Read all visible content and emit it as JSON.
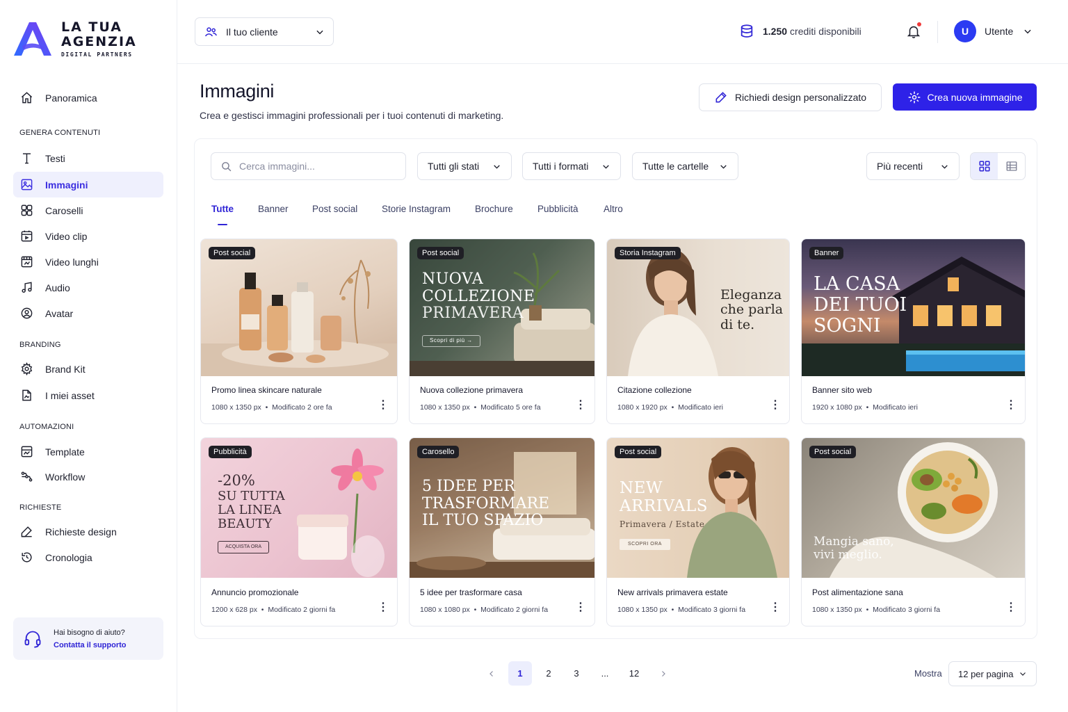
{
  "brand": {
    "line1": "LA TUA",
    "line2": "AGENZIA",
    "line3": "DIGITAL PARTNERS"
  },
  "sidebar": {
    "top": {
      "label": "Panoramica",
      "icon": "home-icon"
    },
    "sections": [
      {
        "title": "GENERA CONTENUTI",
        "items": [
          {
            "label": "Testi",
            "icon": "text-icon"
          },
          {
            "label": "Immagini",
            "icon": "image-icon",
            "active": true
          },
          {
            "label": "Caroselli",
            "icon": "grid-icon"
          },
          {
            "label": "Video clip",
            "icon": "video-icon"
          },
          {
            "label": "Video lunghi",
            "icon": "film-icon"
          },
          {
            "label": "Audio",
            "icon": "music-icon"
          },
          {
            "label": "Avatar",
            "icon": "user-circle-icon"
          }
        ]
      },
      {
        "title": "BRANDING",
        "items": [
          {
            "label": "Brand Kit",
            "icon": "gear-icon"
          },
          {
            "label": "I miei asset",
            "icon": "file-icon"
          }
        ]
      },
      {
        "title": "AUTOMAZIONI",
        "items": [
          {
            "label": "Template",
            "icon": "template-icon"
          },
          {
            "label": "Workflow",
            "icon": "workflow-icon"
          }
        ]
      },
      {
        "title": "RICHIESTE",
        "items": [
          {
            "label": "Richieste design",
            "icon": "pen-icon"
          },
          {
            "label": "Cronologia",
            "icon": "history-icon"
          }
        ]
      }
    ],
    "help": {
      "question": "Hai bisogno di aiuto?",
      "link": "Contatta il supporto"
    }
  },
  "topbar": {
    "client": "Il tuo cliente",
    "credits_amount": "1.250",
    "credits_label": "crediti disponibili",
    "user_initial": "U",
    "user_name": "Utente"
  },
  "page": {
    "title": "Immagini",
    "subtitle": "Crea e gestisci immagini professionali per i tuoi contenuti di marketing.",
    "btn_custom": "Richiedi design personalizzato",
    "btn_create": "Crea nuova immagine"
  },
  "filters": {
    "search_placeholder": "Cerca immagini...",
    "status": "Tutti gli stati",
    "format": "Tutti i formati",
    "folder": "Tutte le cartelle",
    "sort": "Più recenti"
  },
  "tabs": [
    "Tutte",
    "Banner",
    "Post social",
    "Storie Instagram",
    "Brochure",
    "Pubblicità",
    "Altro"
  ],
  "cards": [
    {
      "badge": "Post social",
      "title": "Promo linea skincare naturale",
      "size": "1080 x 1350 px",
      "modified": "Modificato 2 ore fa",
      "overlay": []
    },
    {
      "badge": "Post social",
      "title": "Nuova collezione primavera",
      "size": "1080 x 1350 px",
      "modified": "Modificato 5 ore fa",
      "overlay": [
        "NUOVA",
        "COLLEZIONE",
        "PRIMAVERA"
      ],
      "overlay_small": "Scopri di più →"
    },
    {
      "badge": "Storia Instagram",
      "title": "Citazione collezione",
      "size": "1080 x 1920 px",
      "modified": "Modificato ieri",
      "overlay": [
        "Eleganza",
        "che parla",
        "di te."
      ]
    },
    {
      "badge": "Banner",
      "title": "Banner sito web",
      "size": "1920 x 1080 px",
      "modified": "Modificato ieri",
      "overlay": [
        "LA CASA",
        "DEI TUOI",
        "SOGNI"
      ]
    },
    {
      "badge": "Pubblicità",
      "title": "Annuncio promozionale",
      "size": "1200 x 628 px",
      "modified": "Modificato 2 giorni fa",
      "overlay": [
        "-20%",
        "SU TUTTA",
        "LA LINEA",
        "BEAUTY"
      ],
      "overlay_small": "ACQUISTA ORA"
    },
    {
      "badge": "Carosello",
      "title": "5 idee per trasformare casa",
      "size": "1080 x 1080 px",
      "modified": "Modificato 2 giorni fa",
      "overlay": [
        "5 IDEE PER",
        "TRASFORMARE",
        "IL TUO SPAZIO"
      ]
    },
    {
      "badge": "Post social",
      "title": "New arrivals primavera estate",
      "size": "1080 x 1350 px",
      "modified": "Modificato 3 giorni fa",
      "overlay": [
        "NEW",
        "ARRIVALS"
      ],
      "overlay_sub": "Primavera / Estate",
      "overlay_small": "SCOPRI ORA"
    },
    {
      "badge": "Post social",
      "title": "Post alimentazione sana",
      "size": "1080 x 1350 px",
      "modified": "Modificato 3 giorni fa",
      "overlay": [
        "Mangia sano,",
        "vivi meglio."
      ]
    }
  ],
  "pagination": {
    "pages": [
      "1",
      "2",
      "3",
      "...",
      "12"
    ],
    "current": "1",
    "show_label": "Mostra",
    "per_page": "12 per pagina"
  },
  "colors": {
    "accent": "#2e22e8",
    "active_bg": "#eff0fd",
    "notification": "#ef3b3b"
  }
}
